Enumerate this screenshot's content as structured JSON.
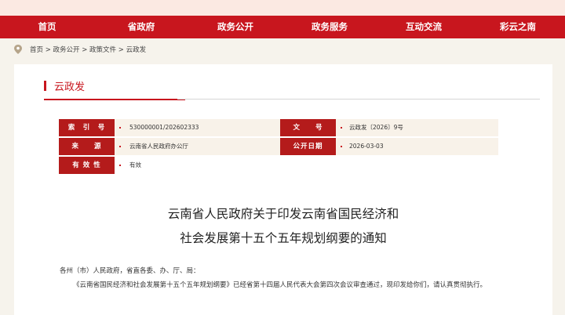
{
  "nav": [
    "首页",
    "省政府",
    "政务公开",
    "政务服务",
    "互动交流",
    "彩云之南"
  ],
  "breadcrumb": "首页 > 政务公开 > 政策文件 > 云政发",
  "section_title": "云政发",
  "meta": {
    "index_label": "索　引　号",
    "index_value": "530000001/202602333",
    "docno_label": "文　　号",
    "docno_value": "云政发〔2026〕9号",
    "source_label": "来　　源",
    "source_value": "云南省人民政府办公厅",
    "date_label": "公开日期",
    "date_value": "2026-03-03",
    "validity_label": "有 效 性",
    "validity_value": "有效"
  },
  "doc_title_line1": "云南省人民政府关于印发云南省国民经济和",
  "doc_title_line2": "社会发展第十五个五年规划纲要的通知",
  "salutation": "各州（市）人民政府，省直各委、办、厅、局：",
  "paragraph1": "《云南省国民经济和社会发展第十五个五年规划纲要》已经省第十四届人民代表大会第四次会议审查通过，现印发给你们，请认真贯彻执行。"
}
